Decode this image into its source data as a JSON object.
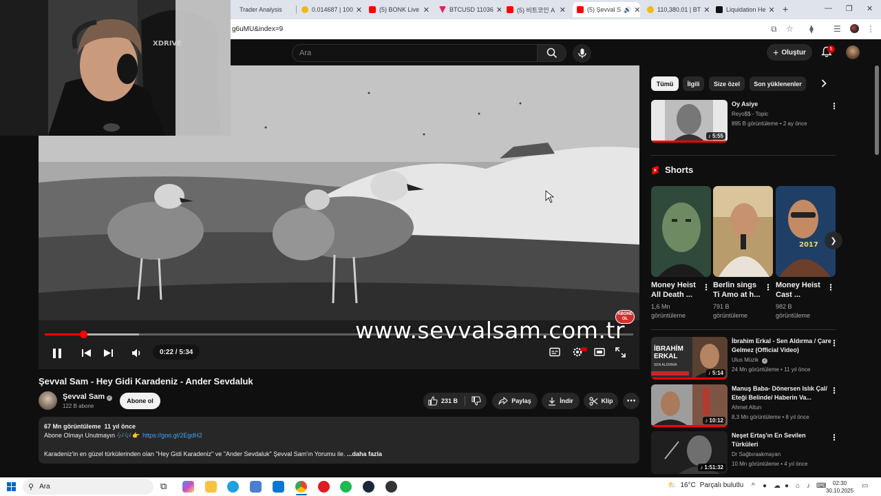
{
  "browser": {
    "tabs": [
      {
        "label": "Trader Analysis",
        "favicon_color": "#2962ff"
      },
      {
        "label": "0.014687 | 100",
        "favicon_color": "#f0b90b"
      },
      {
        "label": "(5) BONK Live",
        "favicon_color": "#ff0000"
      },
      {
        "label": "BTCUSD 11036",
        "favicon_color": "#e0245e"
      },
      {
        "label": "(5) 비트코인 A",
        "favicon_color": "#ff0000"
      },
      {
        "label": "(5) Şevval S",
        "favicon_color": "#ff0000"
      },
      {
        "label": "110,380.01 | BT",
        "favicon_color": "#f0b90b"
      },
      {
        "label": "Liquidation He",
        "favicon_color": "#111111"
      }
    ],
    "active_tab_index": 5,
    "url": "g6uMU&index=9"
  },
  "masthead": {
    "search_placeholder": "Ara",
    "create_label": "Oluştur",
    "notification_count": "5"
  },
  "player": {
    "watermark": "www.sevvalsam.com.tr",
    "time_display": "0:22 / 5:34",
    "progress_fraction": 0.066,
    "buffer_fraction": 0.16,
    "subscribe_badge": "ABONE OL"
  },
  "video": {
    "title": "Şevval Sam - Hey Gidi Karadeniz - Ander Sevdaluk",
    "channel_name": "Şevval Sam",
    "subscribers": "122 B abone",
    "subscribe_label": "Abone ol",
    "like_count": "231 B",
    "share_label": "Paylaş",
    "download_label": "İndir",
    "clip_label": "Klip"
  },
  "description": {
    "views": "67 Mn görüntüleme",
    "age": "11 yıl önce",
    "line2_text": "Abone Olmayı Unutmayın 🎶🎶👉",
    "link": "https://goo.gl/2EgdH2",
    "line3_text": "Karadeniz'in en güzel türkülerinden olan \"Hey Gidi Karadeniz\" ve \"Ander Sevdaluk\" Şevval Sam'ın Yorumu ile.",
    "more_label": "...daha fazla"
  },
  "chips": [
    "Tümü",
    "İlgili",
    "Size özel",
    "Son yüklenenler"
  ],
  "recommendations_top": [
    {
      "title": "Oy Asiye",
      "channel": "Reyo$$ - Topic",
      "meta": "895 B görüntüleme • 2 ay önce",
      "duration": "5:55"
    }
  ],
  "shorts": {
    "heading": "Shorts",
    "items": [
      {
        "title": "Money Heist All Death ...",
        "views_line1": "1,6 Mn",
        "views_line2": "görüntüleme"
      },
      {
        "title": "Berlin sings Ti Amo at h...",
        "views_line1": "791 B",
        "views_line2": "görüntüleme"
      },
      {
        "title": "Money Heist Cast ...",
        "views_line1": "982 B",
        "views_line2": "görüntüleme"
      }
    ]
  },
  "recommendations": [
    {
      "title": "İbrahim Erkal - Sen Aldırma / Çare Gelmez (Official Video)",
      "channel": "Ulus Müzik",
      "meta": "24 Mn görüntüleme • 11 yıl önce",
      "duration": "5:14",
      "thumb_text1": "İBRAHİM",
      "thumb_text2": "ERKAL",
      "thumb_text3": "SEN ALDIRMA"
    },
    {
      "title": "Manuş Baba- Dönersen Islık Çal/ Eteği Belinde/ Haberin Va...",
      "channel": "Ahmet Altun",
      "meta": "8,3 Mn görüntüleme • 8 yıl önce",
      "duration": "10:12"
    },
    {
      "title": "Neşet Ertaş'ın En Sevilen Türküleri",
      "channel": "Dr Sağbıraakmayan",
      "meta": "10 Mn görüntüleme • 4 yıl önce",
      "duration": "1:51:32"
    }
  ],
  "taskbar": {
    "search_label": "Ara",
    "weather": "16°C",
    "weather_desc": "Parçalı bulutlu",
    "time": "02:30",
    "date": "30.10.2025"
  }
}
